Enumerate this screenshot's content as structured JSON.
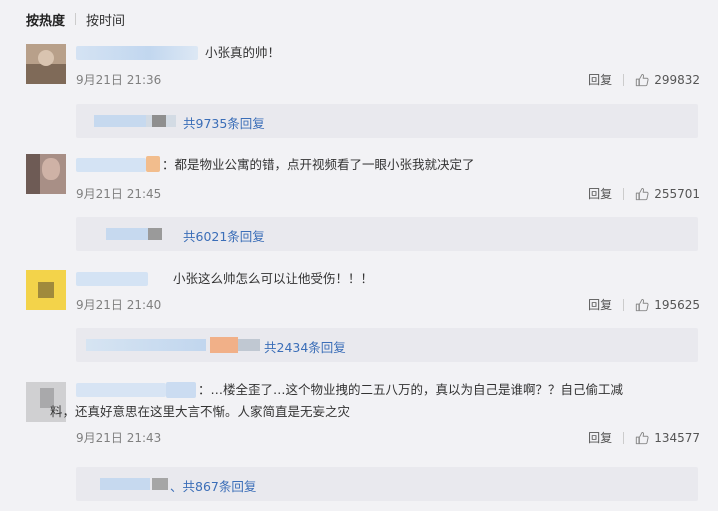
{
  "sort": {
    "hot_label": "按热度",
    "time_label": "按时间"
  },
  "comments": [
    {
      "text": "小张真的帅！",
      "time": "9月21日 21:36",
      "reply": "回复",
      "likes": "299832",
      "replies_link": "共9735条回复"
    },
    {
      "text": "：都是物业公寓的错，点开视频看了一眼小张我就决定了",
      "time": "9月21日 21:45",
      "reply": "回复",
      "likes": "255701",
      "replies_link": "共6021条回复"
    },
    {
      "text": "小张这么帅怎么可以让他受伤！！！",
      "time": "9月21日 21:40",
      "reply": "回复",
      "likes": "195625",
      "replies_link": "共2434条回复"
    },
    {
      "text_line1": "：…楼全歪了…这个物业拽的二五八万的，真以为自己是谁啊？？自己偷工减",
      "text_line2": "料，还真好意思在这里大言不惭。人家简直是无妄之灾",
      "time": "9月21日 21:43",
      "reply": "回复",
      "likes": "134577",
      "replies_link": "、共867条回复"
    }
  ],
  "icons": {
    "like": "thumbs-up-icon"
  },
  "colors": {
    "link": "#3b6eb8",
    "background": "#f2f2f5",
    "reply_box": "#e9e9ee"
  }
}
